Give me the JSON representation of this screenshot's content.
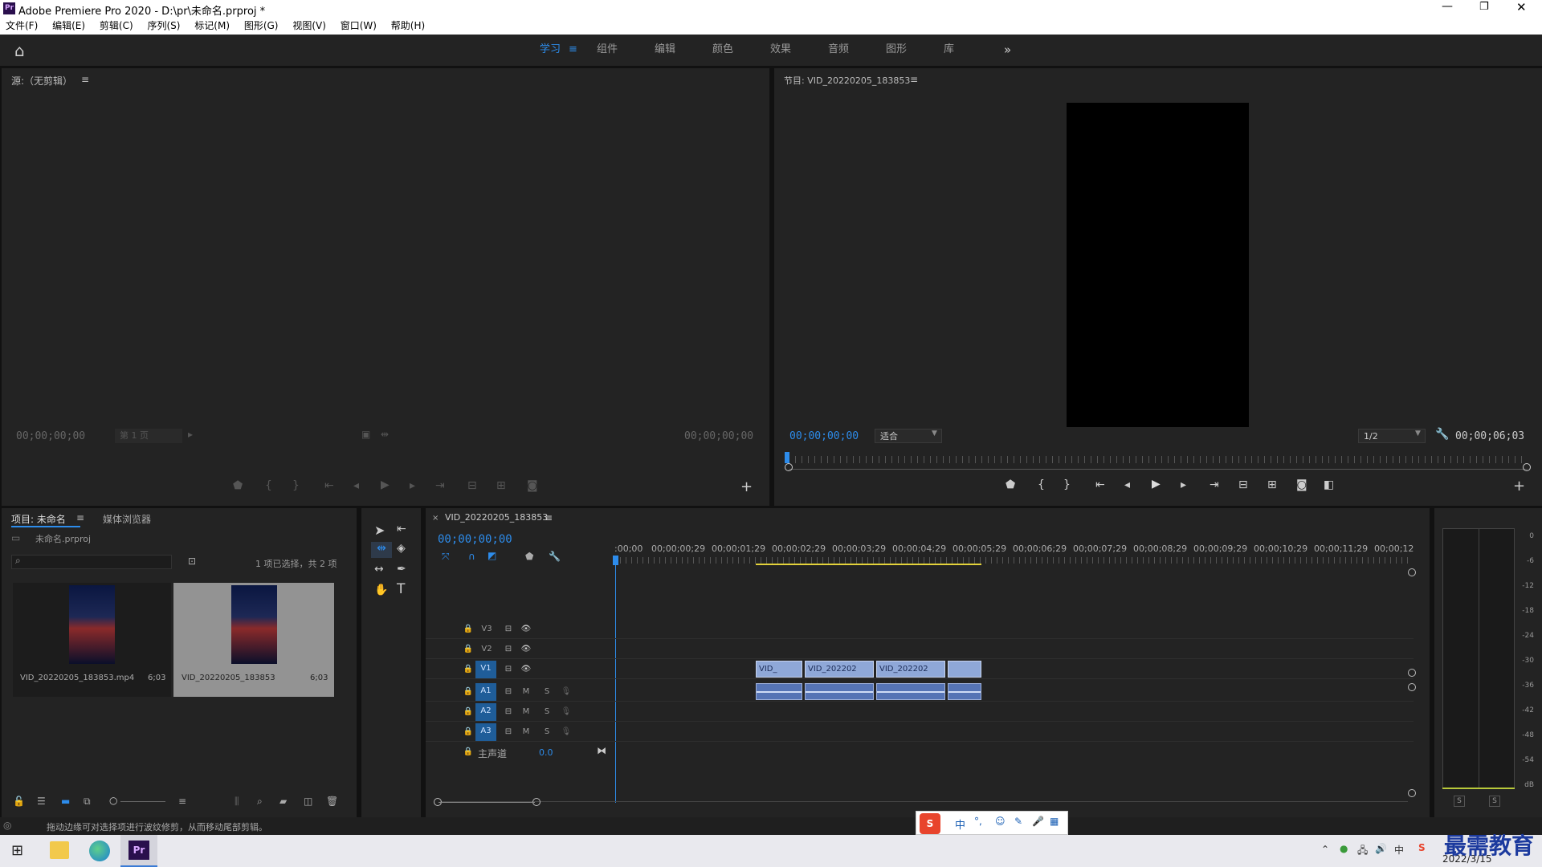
{
  "window": {
    "title": "Adobe Premiere Pro 2020 - D:\\pr\\未命名.prproj *",
    "app_icon": "Pr"
  },
  "menu": [
    "文件(F)",
    "编辑(E)",
    "剪辑(C)",
    "序列(S)",
    "标记(M)",
    "图形(G)",
    "视图(V)",
    "窗口(W)",
    "帮助(H)"
  ],
  "workspaces": {
    "active": "学习",
    "items": [
      "组件",
      "编辑",
      "颜色",
      "效果",
      "音频",
      "图形",
      "库"
    ],
    "more": "»"
  },
  "source": {
    "title": "源:（无剪辑）",
    "tc_left": "00;00;00;00",
    "page": "第 1 页",
    "tc_right": "00;00;00;00"
  },
  "program": {
    "title": "节目: VID_20220205_183853",
    "tc": "00;00;00;00",
    "fit": "适合",
    "quality": "1/2",
    "duration": "00;00;06;03"
  },
  "project": {
    "tabs": [
      "项目: 未命名",
      "媒体浏览器"
    ],
    "file": "未命名.prproj",
    "search_placeholder": "",
    "selection": "1 项已选择，共 2 项",
    "items": [
      {
        "name": "VID_20220205_183853.mp4",
        "dur": "6;03"
      },
      {
        "name": "VID_20220205_183853",
        "dur": "6;03"
      }
    ]
  },
  "timeline": {
    "tab": "VID_20220205_183853",
    "tc": "00;00;00;00",
    "ruler": [
      ":00;00",
      "00;00;00;29",
      "00;00;01;29",
      "00;00;02;29",
      "00;00;03;29",
      "00;00;04;29",
      "00;00;05;29",
      "00;00;06;29",
      "00;00;07;29",
      "00;00;08;29",
      "00;00;09;29",
      "00;00;10;29",
      "00;00;11;29",
      "00;00;12"
    ],
    "video_tracks": [
      "V3",
      "V2",
      "V1"
    ],
    "audio_tracks": [
      "A1",
      "A2",
      "A3"
    ],
    "mix": {
      "label": "主声道",
      "value": "0.0"
    },
    "mute": "M",
    "solo": "S",
    "clips": [
      "VID_",
      "VID_202202",
      "VID_202202",
      ""
    ]
  },
  "vu": {
    "scale": [
      "0",
      "-6",
      "-12",
      "-18",
      "-24",
      "-30",
      "-36",
      "-42",
      "-48",
      "-54",
      "dB"
    ],
    "solo": [
      "S",
      "S"
    ]
  },
  "status": "拖动边缘可对选择项进行波纹修剪，从而移动尾部剪辑。",
  "taskbar": {
    "date": "2022/3/15",
    "watermark": "最需教育",
    "ime": [
      "中",
      "°,"
    ]
  },
  "colors": {
    "accent": "#2d8ceb",
    "panel": "#232323",
    "clip": "#8fa8d8"
  }
}
